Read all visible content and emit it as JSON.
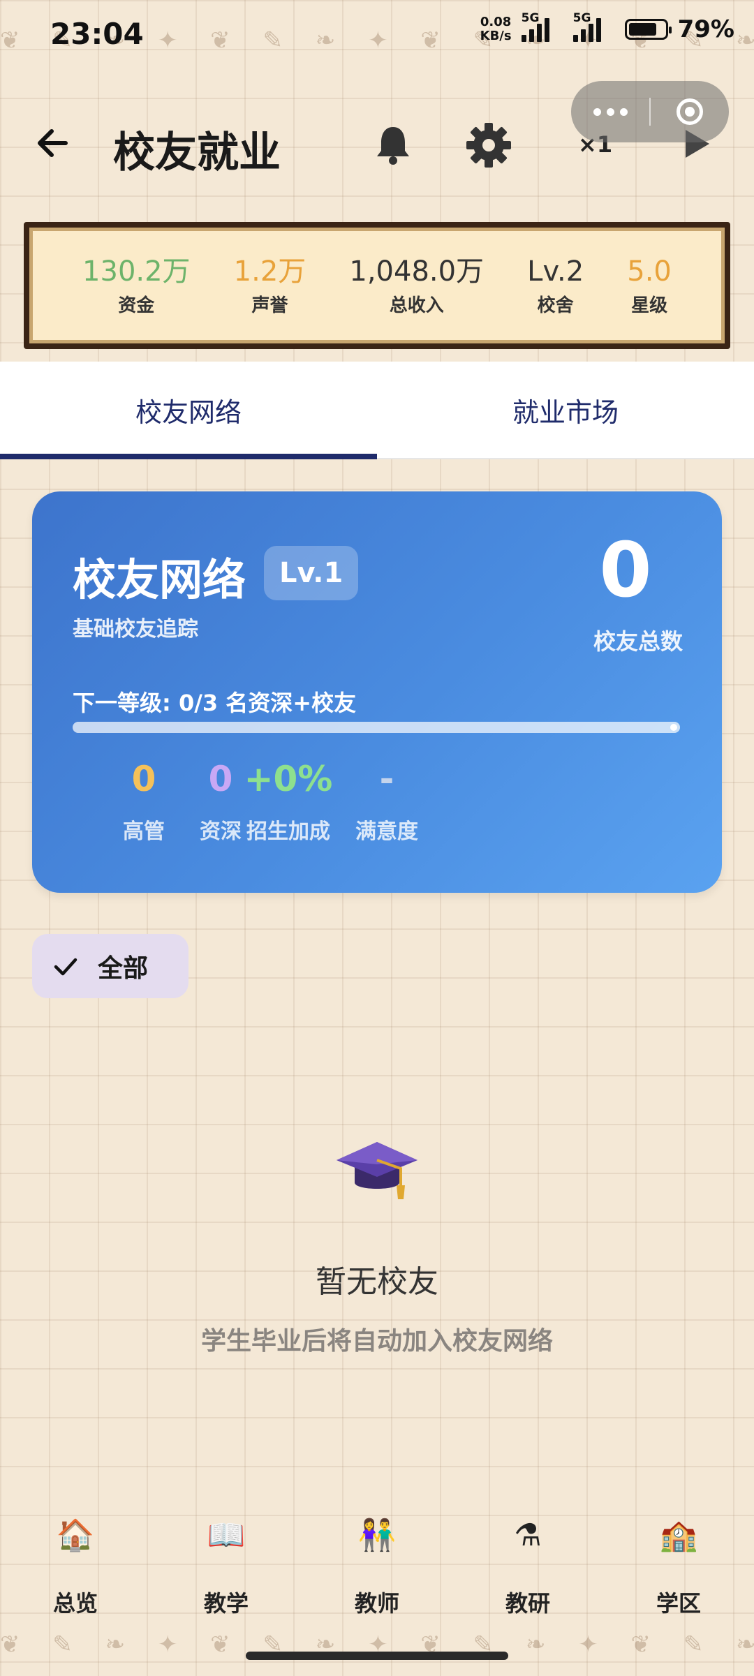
{
  "status_bar": {
    "time": "23:04",
    "net_speed_value": "0.08",
    "net_speed_unit": "KB/s",
    "sim1": "5G",
    "sim2": "5G",
    "battery_percent": "79%",
    "battery_level": 0.79
  },
  "header": {
    "title": "校友就业",
    "speed": "×1",
    "icons": [
      "back-arrow-icon",
      "bell-icon",
      "gear-icon",
      "play-icon",
      "more-icon",
      "target-icon"
    ]
  },
  "stats": [
    {
      "value": "130.2万",
      "label": "资金",
      "color": "#6db36a"
    },
    {
      "value": "1.2万",
      "label": "声誉",
      "color": "#e8a23a"
    },
    {
      "value": "1,048.0万",
      "label": "总收入",
      "color": "#333333"
    },
    {
      "value": "Lv.2",
      "label": "校舍",
      "color": "#333333"
    },
    {
      "value": "5.0",
      "label": "星级",
      "color": "#e8a23a"
    }
  ],
  "tabs": [
    {
      "label": "校友网络",
      "active": true
    },
    {
      "label": "就业市场",
      "active": false
    }
  ],
  "network_card": {
    "title": "校友网络",
    "level": "Lv.1",
    "subtitle": "基础校友追踪",
    "total_count": "0",
    "total_label": "校友总数",
    "next_level_text": "下一等级: 0/3 名资深+校友",
    "progress": 1.0,
    "metrics": [
      {
        "value": "0",
        "label": "高管",
        "color": "#f5c15a"
      },
      {
        "value": "0",
        "label": "资深",
        "color": "#c9a8f5"
      },
      {
        "value": "+0%",
        "label": "招生加成",
        "color": "#8ee08e"
      },
      {
        "value": "-",
        "label": "满意度",
        "color": "#c4d4ec"
      }
    ]
  },
  "filter": {
    "label": "全部",
    "selected": true
  },
  "empty_state": {
    "title": "暂无校友",
    "subtitle": "学生毕业后将自动加入校友网络",
    "icon": "graduation-cap-icon"
  },
  "bottom_nav": [
    {
      "label": "总览",
      "icon": "🏠"
    },
    {
      "label": "教学",
      "icon": "📖"
    },
    {
      "label": "教师",
      "icon": "👫"
    },
    {
      "label": "教研",
      "icon": "⚗"
    },
    {
      "label": "学区",
      "icon": "🏫"
    }
  ]
}
